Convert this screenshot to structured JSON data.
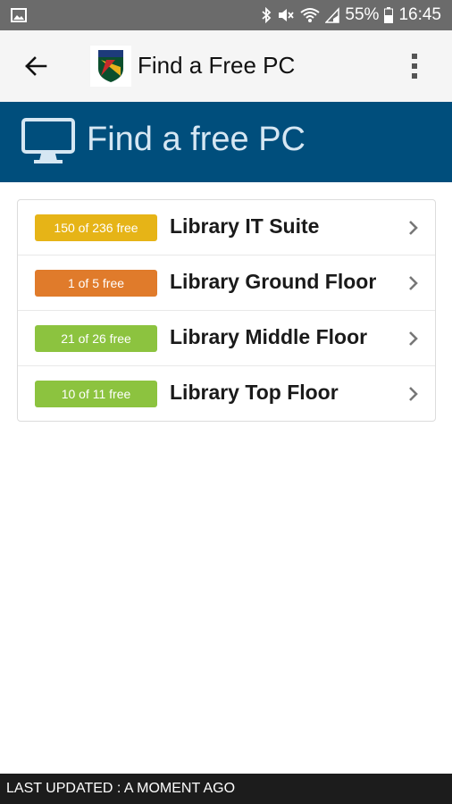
{
  "status_bar": {
    "battery": "55%",
    "time": "16:45",
    "icons": [
      "image-icon",
      "bluetooth-icon",
      "mute-icon",
      "wifi-icon",
      "signal-icon",
      "battery-icon"
    ]
  },
  "app_bar": {
    "title": "Find a Free PC",
    "back_icon": "arrow-left-icon",
    "menu_icon": "more-vert-icon"
  },
  "banner": {
    "title": "Find a free PC",
    "icon": "monitor-icon"
  },
  "locations": [
    {
      "badge": "150 of 236 free",
      "name": "Library IT Suite",
      "color": "#e6b417"
    },
    {
      "badge": "1 of 5 free",
      "name": "Library Ground Floor",
      "color": "#e07b2b"
    },
    {
      "badge": "21 of 26 free",
      "name": "Library Middle Floor",
      "color": "#8cc33f"
    },
    {
      "badge": "10 of 11 free",
      "name": "Library Top Floor",
      "color": "#8cc33f"
    }
  ],
  "footer": {
    "text": "LAST UPDATED : A MOMENT AGO"
  },
  "colors": {
    "banner_bg": "#004e7c",
    "status_bar_bg": "#6b6b6b",
    "footer_bg": "#1c1c1c"
  }
}
